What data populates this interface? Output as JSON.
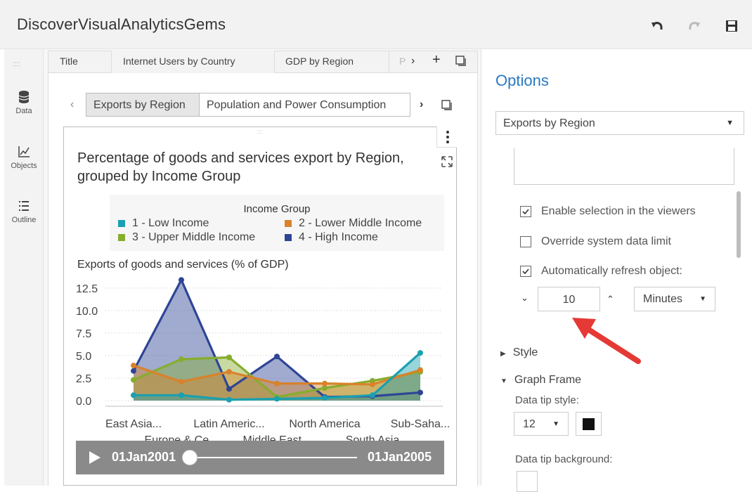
{
  "app": {
    "title": "DiscoverVisualAnalyticsGems"
  },
  "rail": {
    "data_label": "Data",
    "objects_label": "Objects",
    "outline_label": "Outline"
  },
  "top_tabs": [
    "Title",
    "Internet Users by Country",
    "GDP by Region",
    "P"
  ],
  "sub_tabs": [
    "Exports by Region",
    "Population and Power Consumption"
  ],
  "report": {
    "title": "Percentage of goods and services export by Region, grouped by Income Group",
    "legend_title": "Income Group",
    "legend": [
      {
        "label": "1 - Low Income",
        "color": "#1aa0b0"
      },
      {
        "label": "2 - Lower Middle Income",
        "color": "#d9822b"
      },
      {
        "label": "3 - Upper Middle Income",
        "color": "#86ad2e"
      },
      {
        "label": "4 - High Income",
        "color": "#2e4596"
      }
    ],
    "ylabel": "Exports of goods and services (% of GDP)"
  },
  "chart_data": {
    "type": "area",
    "title": "Percentage of goods and services export by Region, grouped by Income Group",
    "ylabel": "Exports of goods and services (% of GDP)",
    "ylim": [
      0,
      13.5
    ],
    "yticks": [
      "12.5",
      "10.0",
      "7.5",
      "5.0",
      "2.5",
      "0.0"
    ],
    "categories": [
      "East Asia...",
      "Europe & Ce...",
      "Latin Americ...",
      "Middle East...",
      "North America",
      "South Asia",
      "Sub-Saha..."
    ],
    "categories_note": "",
    "series": [
      {
        "name": "1 - Low Income",
        "color": "#1aa0b0",
        "values": [
          0.6,
          0.6,
          0.1,
          0.2,
          0.3,
          0.6,
          5.3
        ]
      },
      {
        "name": "2 - Lower Middle Income",
        "color": "#d9822b",
        "values": [
          3.9,
          2.1,
          3.2,
          1.9,
          1.9,
          1.8,
          3.4
        ]
      },
      {
        "name": "3 - Upper Middle Income",
        "color": "#86ad2e",
        "values": [
          2.3,
          4.6,
          4.8,
          0.4,
          1.4,
          2.2,
          3.2
        ]
      },
      {
        "name": "4 - High Income",
        "color": "#2e4596",
        "values": [
          3.3,
          13.4,
          1.3,
          4.9,
          0.4,
          0.5,
          0.9
        ]
      }
    ],
    "grid": true
  },
  "player": {
    "start": "01Jan2001",
    "end": "01Jan2005"
  },
  "options": {
    "title": "Options",
    "object_select": "Exports by Region",
    "enable_selection": "Enable selection in the viewers",
    "override_limit": "Override system data limit",
    "auto_refresh": "Automatically refresh object:",
    "refresh_value": "10",
    "refresh_unit": "Minutes",
    "style_section": "Style",
    "graph_frame_section": "Graph Frame",
    "data_tip_style_label": "Data tip style:",
    "data_tip_font_size": "12",
    "data_tip_background_label": "Data tip background:"
  }
}
